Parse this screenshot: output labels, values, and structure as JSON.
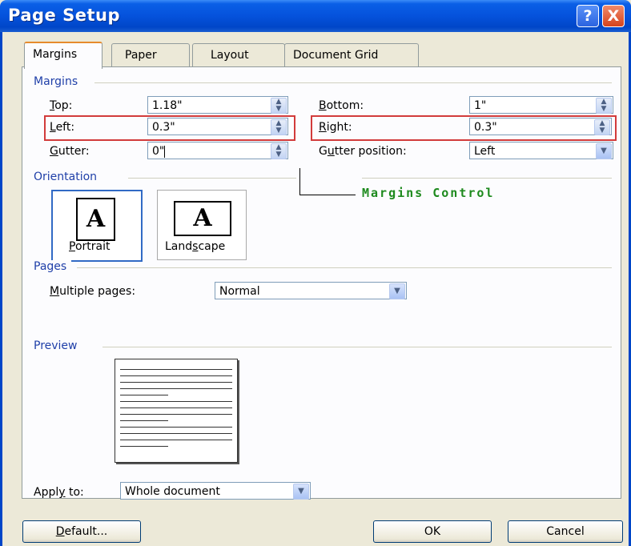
{
  "window": {
    "title": "Page Setup",
    "help": "?",
    "close": "X"
  },
  "tabs": [
    {
      "label": "Margins"
    },
    {
      "label": "Paper"
    },
    {
      "label": "Layout"
    },
    {
      "label": "Document Grid"
    }
  ],
  "margins": {
    "section": "Margins",
    "top": {
      "label_u": "T",
      "label_rest": "op:",
      "value": "1.18\""
    },
    "bottom": {
      "label_u": "B",
      "label_rest": "ottom:",
      "value": "1\""
    },
    "left": {
      "label_u": "L",
      "label_rest": "eft:",
      "value": "0.3\""
    },
    "right": {
      "label_u": "R",
      "label_rest": "ight:",
      "value": "0.3\""
    },
    "gutter": {
      "label_u": "G",
      "label_rest": "utter:",
      "value": "0\""
    },
    "gutter_position": {
      "label_pre": "G",
      "label_u": "u",
      "label_rest": "tter position:",
      "value": "Left"
    }
  },
  "annotation": "Margins Control",
  "orientation": {
    "section": "Orientation",
    "portrait": {
      "label_u": "P",
      "label_rest": "ortrait",
      "glyph": "A"
    },
    "landscape": {
      "label_pre": "Land",
      "label_u": "s",
      "label_rest": "cape",
      "glyph": "A"
    }
  },
  "pages": {
    "section": "Pages",
    "label_u": "M",
    "label_rest": "ultiple pages:",
    "value": "Normal"
  },
  "preview": {
    "section": "Preview"
  },
  "apply": {
    "label_pre": "Appl",
    "label_u": "y",
    "label_rest": " to:",
    "value": "Whole document"
  },
  "buttons": {
    "default_u": "D",
    "default_rest": "efault...",
    "ok": "OK",
    "cancel": "Cancel"
  }
}
